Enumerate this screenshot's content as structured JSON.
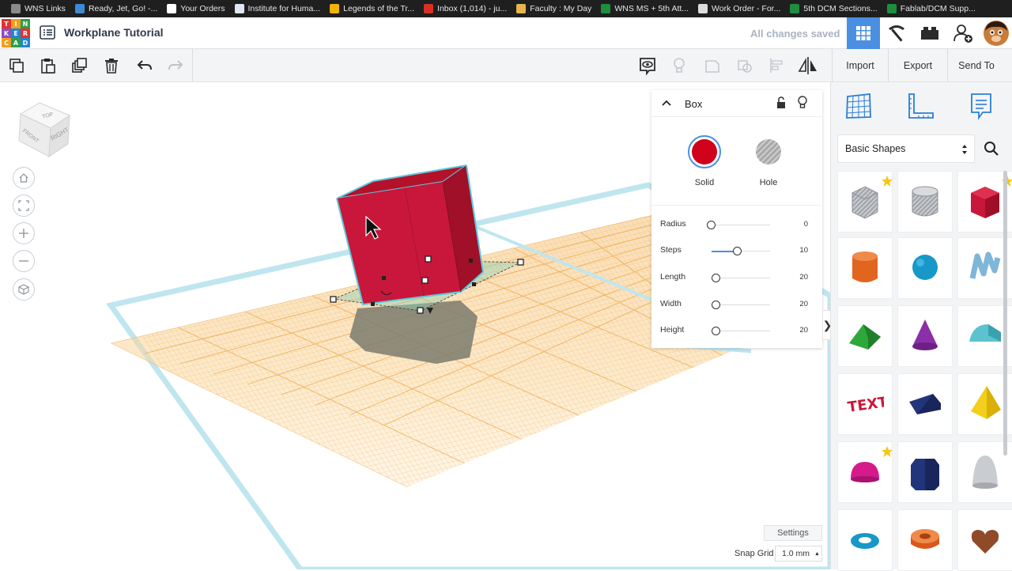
{
  "bookmarks": [
    {
      "label": "WNS Links",
      "color": "#8a8a8a"
    },
    {
      "label": "Ready, Jet, Go! -...",
      "color": "#3b8bd4"
    },
    {
      "label": "Your Orders",
      "color": "#ffffff"
    },
    {
      "label": "Institute for Huma...",
      "color": "#dfe7f0"
    },
    {
      "label": "Legends of the Tr...",
      "color": "#f2b400"
    },
    {
      "label": "Inbox (1,014) - ju...",
      "color": "#d93025"
    },
    {
      "label": "Faculty : My Day",
      "color": "#e8b44a"
    },
    {
      "label": "WNS MS + 5th Att...",
      "color": "#1e8e3e"
    },
    {
      "label": "Work Order - For...",
      "color": "#dddddd"
    },
    {
      "label": "5th DCM Sections...",
      "color": "#1e8e3e"
    },
    {
      "label": "Fablab/DCM Supp...",
      "color": "#1e8e3e"
    }
  ],
  "app": {
    "logo_letters": [
      "T",
      "I",
      "N",
      "K",
      "E",
      "R",
      "C",
      "A",
      "D"
    ],
    "title": "Workplane Tutorial",
    "save_status": "All changes saved"
  },
  "toolbar": {
    "import": "Import",
    "export": "Export",
    "send_to": "Send To"
  },
  "viewcube": {
    "top": "TOP",
    "front": "FRONT",
    "right": "RIGHT"
  },
  "inspector": {
    "title": "Box",
    "solid_label": "Solid",
    "hole_label": "Hole",
    "solid_color": "#d0021b",
    "params": [
      {
        "label": "Radius",
        "value": "0",
        "fraction": 0.0
      },
      {
        "label": "Steps",
        "value": "10",
        "fraction": 0.45
      },
      {
        "label": "Length",
        "value": "20",
        "fraction": 0.08
      },
      {
        "label": "Width",
        "value": "20",
        "fraction": 0.08
      },
      {
        "label": "Height",
        "value": "20",
        "fraction": 0.08
      }
    ]
  },
  "footer": {
    "settings": "Settings",
    "snap_label": "Snap Grid",
    "snap_value": "1.0 mm"
  },
  "sidebar": {
    "category": "Basic Shapes",
    "shapes": [
      {
        "name": "Box (Hole)",
        "icon": "striped-box-icon",
        "starred": true
      },
      {
        "name": "Cylinder (Hole)",
        "icon": "striped-cylinder-icon",
        "starred": false
      },
      {
        "name": "Box",
        "icon": "red-box-icon",
        "starred": true
      },
      {
        "name": "Cylinder",
        "icon": "orange-cylinder-icon",
        "starred": false
      },
      {
        "name": "Sphere",
        "icon": "blue-sphere-icon",
        "starred": false
      },
      {
        "name": "Scribble",
        "icon": "scribble-icon",
        "starred": false
      },
      {
        "name": "Roof",
        "icon": "green-roof-icon",
        "starred": false
      },
      {
        "name": "Cone",
        "icon": "purple-cone-icon",
        "starred": false
      },
      {
        "name": "Round Roof",
        "icon": "teal-round-roof-icon",
        "starred": false
      },
      {
        "name": "Text",
        "icon": "red-text-icon",
        "starred": false
      },
      {
        "name": "Wedge",
        "icon": "navy-wedge-icon",
        "starred": false
      },
      {
        "name": "Pyramid",
        "icon": "yellow-pyramid-icon",
        "starred": false
      },
      {
        "name": "Half Sphere",
        "icon": "magenta-half-sphere-icon",
        "starred": true
      },
      {
        "name": "Polygon",
        "icon": "navy-polygon-icon",
        "starred": false
      },
      {
        "name": "Paraboloid",
        "icon": "grey-paraboloid-icon",
        "starred": false
      },
      {
        "name": "Torus",
        "icon": "blue-torus-icon",
        "starred": false
      },
      {
        "name": "Tube",
        "icon": "orange-tube-icon",
        "starred": false
      },
      {
        "name": "Heart",
        "icon": "brown-heart-icon",
        "starred": false
      }
    ]
  }
}
